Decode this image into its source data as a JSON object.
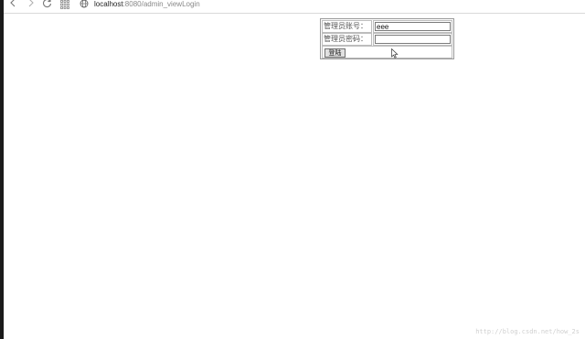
{
  "browser": {
    "url_host": "localhost",
    "url_rest": ":8080/admin_viewLogin",
    "icons": [
      "back-icon",
      "forward-icon",
      "reload-icon",
      "apps-icon",
      "globe-icon"
    ]
  },
  "login_form": {
    "account_label": "管理员账号：",
    "account_value": "eee",
    "password_label": "管理员密码：",
    "password_value": "",
    "login_button": "登陆"
  },
  "watermark": "http://blog.csdn.net/how_2s"
}
